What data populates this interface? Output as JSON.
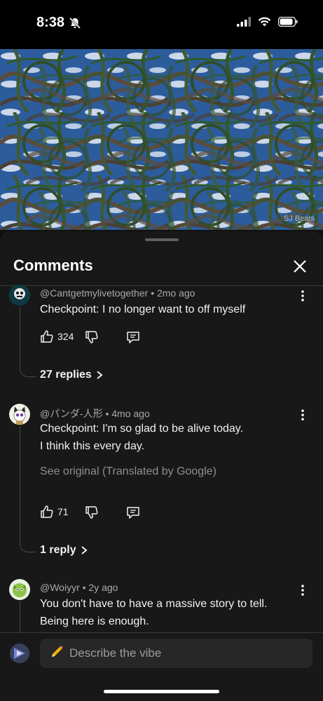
{
  "status_bar": {
    "time": "8:38",
    "icons": [
      "bell-slash-icon",
      "cellular-signal-icon",
      "wifi-icon",
      "battery-icon"
    ]
  },
  "video": {
    "watermark": "SJ Beats",
    "colors": {
      "sky": "#2a5a98",
      "branch": "#5a4a3a",
      "leaf": "#2f5a2a"
    }
  },
  "panel": {
    "title": "Comments",
    "close_icon": "close-icon"
  },
  "comments": [
    {
      "author": "@Cantgetmylivetogether",
      "age": "2mo ago",
      "text": [
        "Checkpoint: I no longer want to off myself"
      ],
      "likes": "324",
      "replies": "27 replies"
    },
    {
      "author": "@パンダ-人形",
      "age": "4mo ago",
      "text": [
        "Checkpoint: I'm so glad to be alive today.",
        "I think this every day."
      ],
      "translation_note": "See original (Translated by Google)",
      "likes": "71",
      "replies": "1 reply"
    },
    {
      "author": "@Woiyyr",
      "age": "2y ago",
      "text": [
        "You don't have to have a massive story to tell.",
        "Being here is enough."
      ]
    }
  ],
  "composer": {
    "placeholder": "Describe the vibe",
    "icon": "pencil-icon"
  },
  "separator": "•"
}
